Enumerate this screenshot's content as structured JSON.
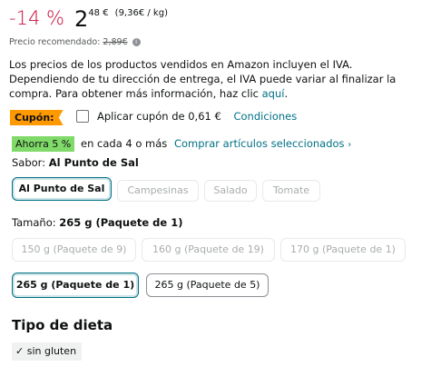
{
  "price": {
    "discount": "-14 %",
    "whole": "2",
    "fraction": "48 €",
    "unit_price": "(9,36€ / kg)"
  },
  "rrp": {
    "label": "Precio recomendado:",
    "value": "2,89€",
    "info_icon": "info-icon"
  },
  "vat": {
    "text": "Los precios de los productos vendidos en Amazon incluyen el IVA. Dependiendo de tu dirección de entrega, el IVA puede variar al finalizar la compra. Para obtener más información, haz clic ",
    "link": "aquí",
    "end": "."
  },
  "coupon": {
    "badge": "Cupón:",
    "text": "Aplicar cupón de 0,61 €",
    "conditions": "Condiciones"
  },
  "savings": {
    "badge": "Ahorra 5 %",
    "text": "en cada 4 o más",
    "link": "Comprar artículos seleccionados",
    "chevron": "›"
  },
  "flavor": {
    "label": "Sabor:",
    "selected": "Al Punto de Sal",
    "options": [
      "Al Punto de Sal",
      "Campesinas",
      "Salado",
      "Tomate"
    ]
  },
  "size": {
    "label": "Tamaño:",
    "selected": "265 g (Paquete de 1)",
    "options_row1": [
      "150 g (Paquete de 9)",
      "160 g (Paquete de 19)",
      "170 g (Paquete de 1)"
    ],
    "options_row2": [
      "265 g (Paquete de 1)",
      "265 g (Paquete de 5)"
    ]
  },
  "diet": {
    "heading": "Tipo de dieta",
    "tag": "sin gluten",
    "check": "✓"
  },
  "colors": {
    "discount": "#cc0c39",
    "link": "#007185",
    "coupon": "#ff9900",
    "savings": "#7fda69"
  }
}
